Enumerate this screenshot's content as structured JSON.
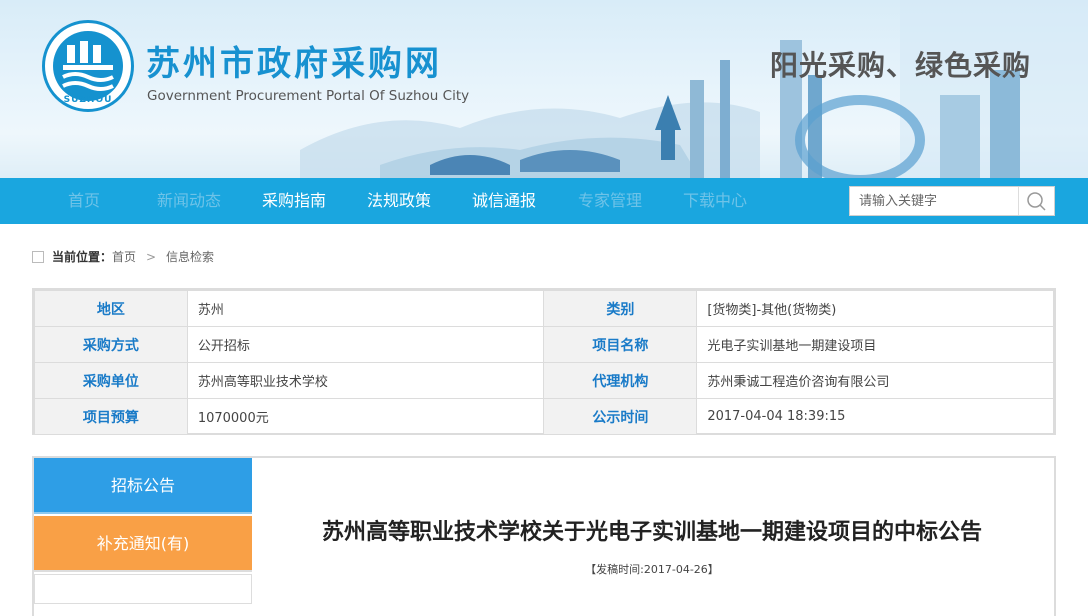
{
  "header": {
    "logo_text": "SUZHOU",
    "title": "苏州市政府采购网",
    "subtitle": "Government Procurement Portal Of Suzhou City",
    "slogan": "阳光采购、绿色采购"
  },
  "nav": {
    "items": [
      {
        "label": "首页"
      },
      {
        "label": "新闻动态"
      },
      {
        "label": "采购指南"
      },
      {
        "label": "法规政策"
      },
      {
        "label": "诚信通报"
      },
      {
        "label": "专家管理"
      },
      {
        "label": "下载中心"
      }
    ],
    "search_placeholder": "请输入关键字"
  },
  "breadcrumb": {
    "prefix": "当前位置：",
    "items": [
      "首页",
      "信息检索"
    ]
  },
  "info": {
    "rows": [
      {
        "l1": "地区",
        "v1": "苏州",
        "l2": "类别",
        "v2": "[货物类]-其他(货物类)"
      },
      {
        "l1": "采购方式",
        "v1": "公开招标",
        "l2": "项目名称",
        "v2": "光电子实训基地一期建设项目"
      },
      {
        "l1": "采购单位",
        "v1": "苏州高等职业技术学校",
        "l2": "代理机构",
        "v2": "苏州秉诚工程造价咨询有限公司"
      },
      {
        "l1": "项目预算",
        "v1": "1070000元",
        "l2": "公示时间",
        "v2": "2017-04-04 18:39:15"
      }
    ]
  },
  "sidebar": {
    "tab1": "招标公告",
    "tab2": "补充通知(有)",
    "tab3": ""
  },
  "notice": {
    "title": "苏州高等职业技术学校关于光电子实训基地一期建设项目的中标公告",
    "date": "【发稿时间:2017-04-26】"
  },
  "colors": {
    "nav_bg": "#1aa6df",
    "title_blue": "#1791d0",
    "tab_blue": "#2e9ee6",
    "tab_orange": "#f9a046"
  }
}
